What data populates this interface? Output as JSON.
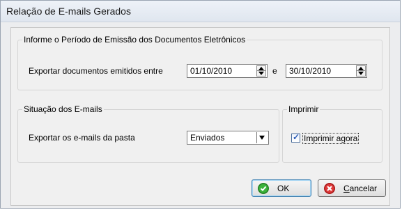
{
  "window": {
    "title": "Relação de E-mails Gerados"
  },
  "periodo": {
    "legend": "Informe o Período de Emissão dos Documentos Eletrônicos",
    "label": "Exportar documentos emitidos entre",
    "date_from": "01/10/2010",
    "separator": "e",
    "date_to": "30/10/2010"
  },
  "situacao": {
    "legend": "Situação dos E-mails",
    "label": "Exportar os e-mails da pasta",
    "folder_selected": "Enviados"
  },
  "imprimir": {
    "legend": "Imprimir",
    "checkbox_label": "Imprimir agora",
    "checked": true
  },
  "buttons": {
    "ok_label": "OK",
    "cancel_label_u": "C",
    "cancel_label_rest": "ancelar"
  },
  "colors": {
    "ok_icon": "#2f9a2f",
    "cancel_icon": "#d42424"
  }
}
